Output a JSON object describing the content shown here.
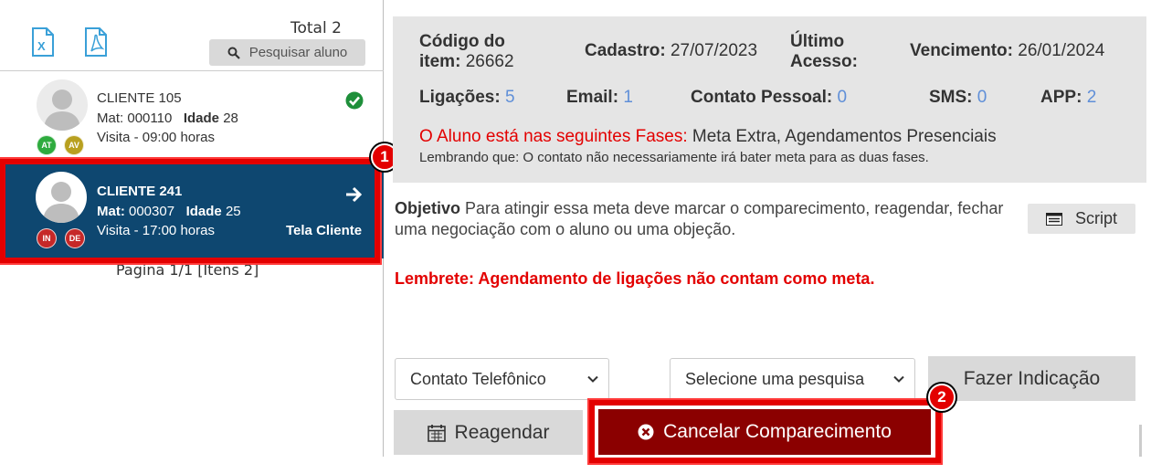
{
  "sidebar": {
    "total_label": "Total 2",
    "search_label": "Pesquisar aluno",
    "icons": {
      "excel": "excel-file-icon",
      "pdf": "pdf-file-icon",
      "search": "search-icon"
    },
    "clients": [
      {
        "name": "CLIENTE 105",
        "mat_label": "Mat:",
        "mat": "000110",
        "idade_label": "Idade",
        "idade": "28",
        "visita": "Visita - 09:00 horas",
        "badges": [
          {
            "text": "AT",
            "color": "#2eab3e"
          },
          {
            "text": "AV",
            "color": "#b8a020"
          }
        ],
        "status_icon": "check-circle-icon"
      },
      {
        "name": "CLIENTE 241",
        "mat_label": "Mat:",
        "mat": "000307",
        "idade_label": "Idade",
        "idade": "25",
        "visita": "Visita - 17:00 horas",
        "link": "Tela Cliente",
        "badges": [
          {
            "text": "IN",
            "color": "#c62828"
          },
          {
            "text": "DE",
            "color": "#c62828"
          }
        ],
        "action_icon": "arrow-right-icon"
      }
    ],
    "pagination": "Pagina 1/1 [Itens 2]"
  },
  "annotations": {
    "step1": "1",
    "step2": "2",
    "color": "#e30000"
  },
  "info": {
    "codigo_label_1": "Código do",
    "codigo_label_2": "item:",
    "codigo": "26662",
    "cadastro_label": "Cadastro:",
    "cadastro": "27/07/2023",
    "ultimo_label_1": "Último",
    "ultimo_label_2": "Acesso:",
    "vencimento_label": "Vencimento:",
    "vencimento": "26/01/2024",
    "ligacoes_label": "Ligações:",
    "ligacoes": "5",
    "email_label": "Email:",
    "email": "1",
    "contato_label": "Contato Pessoal:",
    "contato": "0",
    "sms_label": "SMS:",
    "sms": "0",
    "app_label": "APP:",
    "app": "2",
    "phases_prefix": "O Aluno está nas seguintes Fases:",
    "phases": "Meta Extra, Agendamentos Presenciais",
    "phases_note": "Lembrando que: O contato não necessariamente irá bater meta para as duas fases."
  },
  "objective": {
    "title": "Objetivo",
    "text": "Para atingir essa meta deve marcar o comparecimento, reagendar, fechar uma negociação com o aluno ou uma objeção.",
    "script_label": "Script",
    "lembrete": "Lembrete: Agendamento de ligações não contam como meta."
  },
  "actions": {
    "contact_select": "Contato Telefônico",
    "survey_select": "Selecione uma pesquisa",
    "indicacao_label": "Fazer Indicação",
    "reagendar_label": "Reagendar",
    "cancelar_label": "Cancelar Comparecimento"
  },
  "colors": {
    "selected_row": "#0e4770",
    "info_bg": "#e5e5e5",
    "count_blue": "#5f8fd8",
    "cancel_button": "#8b0000",
    "alert_red": "#e30000"
  }
}
